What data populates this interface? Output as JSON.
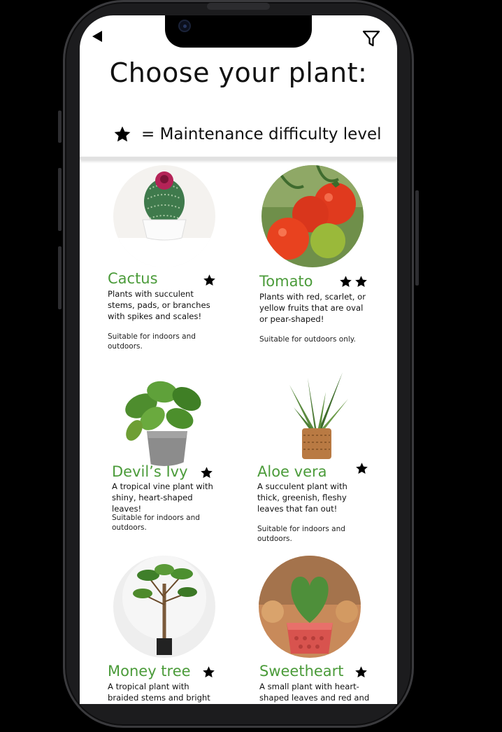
{
  "header": {
    "title": "Choose your plant:",
    "legend_text": "= Maintenance difficulty level"
  },
  "icons": {
    "back": "back-arrow-icon",
    "filter": "filter-icon",
    "star": "star-icon"
  },
  "colors": {
    "accent_green": "#4b9b3a",
    "text": "#111111",
    "background": "#ffffff"
  },
  "plants": [
    {
      "name": "Cactus",
      "difficulty": 1,
      "description": "Plants with succulent stems, pads, or branches with spikes and scales!",
      "suitability": "Suitable for indoors and outdoors."
    },
    {
      "name": "Tomato",
      "difficulty": 2,
      "description": "Plants with red, scarlet, or yellow fruits that are oval or pear-shaped!",
      "suitability": "Suitable for outdoors only."
    },
    {
      "name": "Devil’s Ivy",
      "difficulty": 1,
      "description": "A tropical vine plant with shiny, heart-shaped leaves!",
      "suitability": "Suitable for indoors and outdoors."
    },
    {
      "name": "Aloe vera",
      "difficulty": 1,
      "description": "A succulent plant with thick, greenish, fleshy leaves that fan out!",
      "suitability": "Suitable for indoors and outdoors."
    },
    {
      "name": "Money tree",
      "difficulty": 1,
      "description": "A tropical plant with braided stems and bright",
      "suitability": ""
    },
    {
      "name": "Sweetheart",
      "difficulty": 1,
      "description": "A small plant with heart-shaped leaves and red and",
      "suitability": ""
    }
  ]
}
